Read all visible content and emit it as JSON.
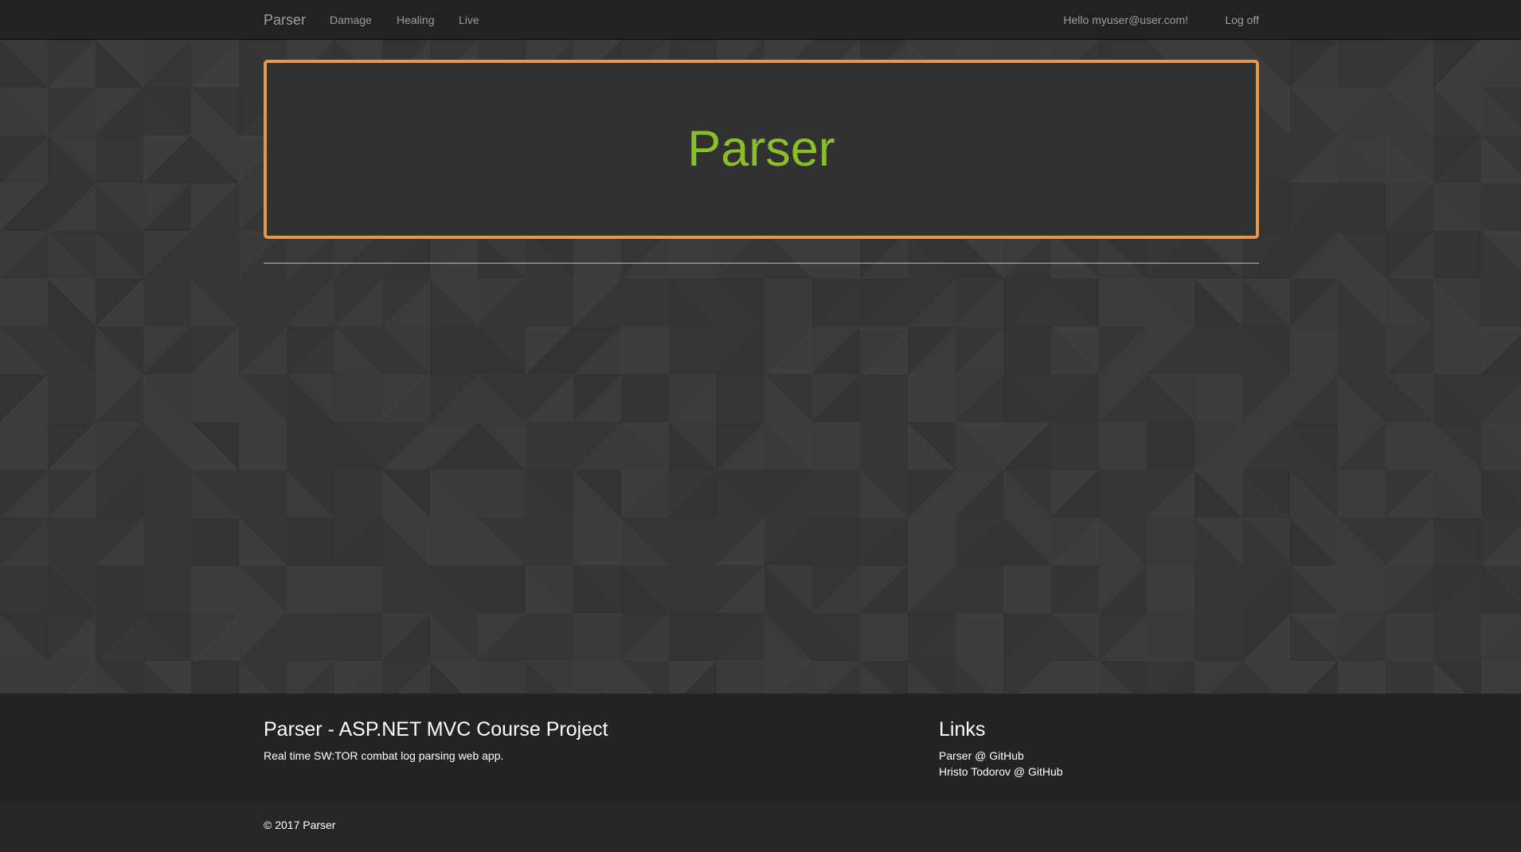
{
  "nav": {
    "brand": "Parser",
    "links": [
      "Damage",
      "Healing",
      "Live"
    ],
    "greeting": "Hello myuser@user.com!",
    "logoff": "Log off"
  },
  "jumbotron": {
    "title": "Parser"
  },
  "footer": {
    "left": {
      "heading": "Parser - ASP.NET MVC Course Project",
      "text": "Real time SW:TOR combat log parsing web app."
    },
    "right": {
      "heading": "Links",
      "links": [
        "Parser @ GitHub",
        "Hristo Todorov @ GitHub"
      ]
    },
    "copyright": "© 2017 Parser"
  },
  "colors": {
    "navbar": "#222222",
    "background": "#383838",
    "jumbotron_border": "#e6974b",
    "jumbotron_title": "#8bbf2a",
    "footer": "#232323"
  }
}
